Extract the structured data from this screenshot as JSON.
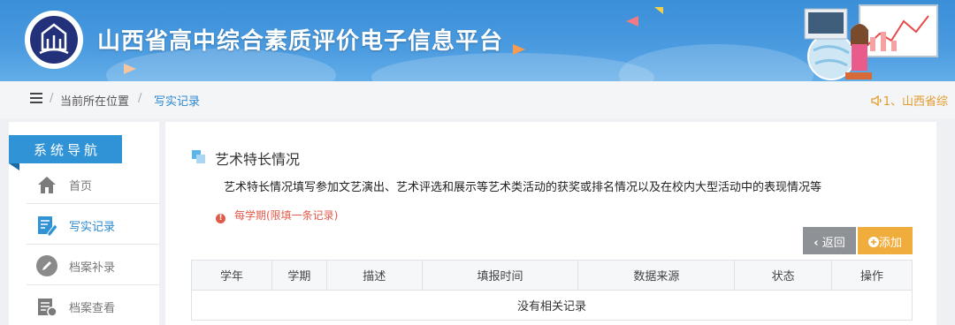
{
  "header": {
    "site_title": "山西省高中综合素质评价电子信息平台"
  },
  "breadcrumb": {
    "location_label": "当前所在位置",
    "separator": "/",
    "current": "写实记录",
    "notice": "1、山西省综"
  },
  "sidebar": {
    "title": "系统导航",
    "items": [
      {
        "label": "首页",
        "icon": "home-icon"
      },
      {
        "label": "写实记录",
        "icon": "edit-note-icon",
        "active": true
      },
      {
        "label": "档案补录",
        "icon": "pencil-icon"
      },
      {
        "label": "档案查看",
        "icon": "archive-icon"
      }
    ]
  },
  "section": {
    "title": "艺术特长情况",
    "description": "艺术特长情况填写参加文艺演出、艺术评选和展示等艺术类活动的获奖或排名情况以及在校内大型活动中的表现情况等",
    "warning_icon": "!",
    "warning": "每学期(限填一条记录)"
  },
  "buttons": {
    "back": "返回",
    "add": "添加"
  },
  "table": {
    "columns": [
      "学年",
      "学期",
      "描述",
      "填报时间",
      "数据来源",
      "状态",
      "操作"
    ],
    "empty_text": "没有相关记录"
  },
  "colors": {
    "accent": "#2f93d6",
    "warning": "#e05a4a",
    "add_button": "#f0ad3c",
    "back_button": "#8e9296"
  }
}
